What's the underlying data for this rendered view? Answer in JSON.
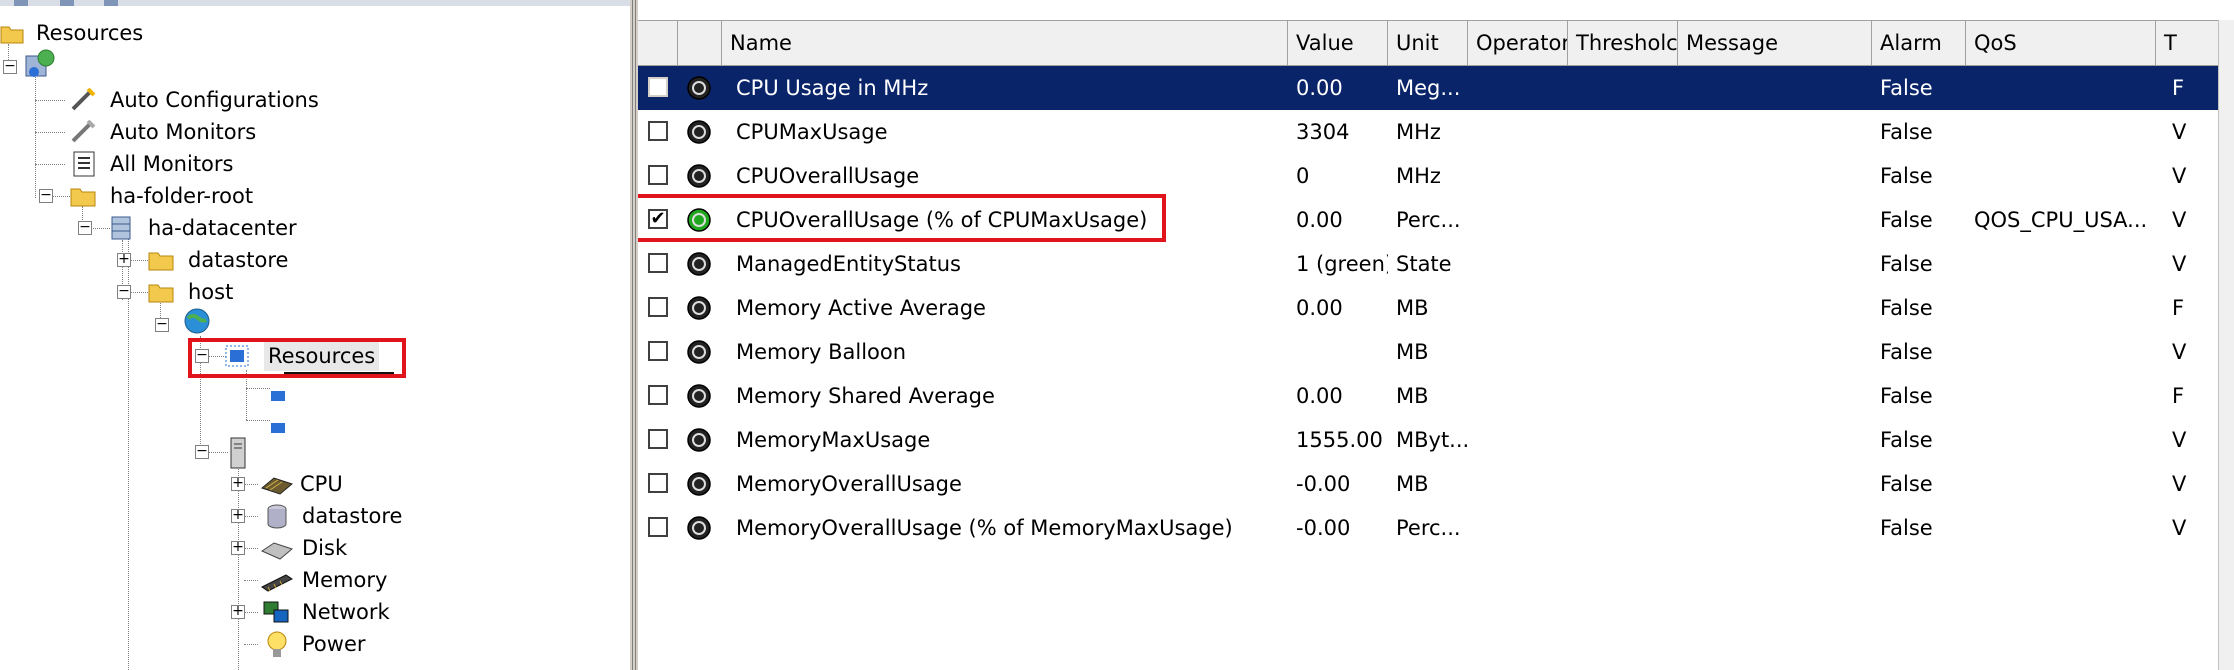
{
  "tree": {
    "root_label": "Resources",
    "items": [
      {
        "label": "Auto Configurations",
        "icon": "wand-icon"
      },
      {
        "label": "Auto Monitors",
        "icon": "wand-icon"
      },
      {
        "label": "All Monitors",
        "icon": "list-icon"
      },
      {
        "label": "ha-folder-root",
        "icon": "folder-icon"
      },
      {
        "label": "ha-datacenter",
        "icon": "datacenter-icon"
      },
      {
        "label": "datastore",
        "icon": "folder-icon"
      },
      {
        "label": "host",
        "icon": "folder-icon"
      },
      {
        "label": "Resources",
        "icon": "resource-pool-icon"
      },
      {
        "label": "CPU",
        "icon": "cpu-icon"
      },
      {
        "label": "datastore",
        "icon": "database-icon"
      },
      {
        "label": "Disk",
        "icon": "disk-icon"
      },
      {
        "label": "Memory",
        "icon": "memory-icon"
      },
      {
        "label": "Network",
        "icon": "network-icon"
      },
      {
        "label": "Power",
        "icon": "power-bulb-icon"
      }
    ]
  },
  "list": {
    "headers": [
      "Name",
      "Value",
      "Unit",
      "Operator",
      "Thresholc",
      "Message",
      "Alarm",
      "QoS",
      "T"
    ],
    "rows": [
      {
        "checked": false,
        "status": "grey",
        "name": "CPU Usage in MHz",
        "value": "0.00",
        "unit": "Meg...",
        "alarm": "False",
        "qos": "",
        "t": "F"
      },
      {
        "checked": false,
        "status": "grey",
        "name": "CPUMaxUsage",
        "value": "3304",
        "unit": "MHz",
        "alarm": "False",
        "qos": "",
        "t": "V"
      },
      {
        "checked": false,
        "status": "grey",
        "name": "CPUOverallUsage",
        "value": "0",
        "unit": "MHz",
        "alarm": "False",
        "qos": "",
        "t": "V"
      },
      {
        "checked": true,
        "status": "green",
        "name": "CPUOverallUsage (% of CPUMaxUsage)",
        "value": "0.00",
        "unit": "Perc...",
        "alarm": "False",
        "qos": "QOS_CPU_USA...",
        "t": "V"
      },
      {
        "checked": false,
        "status": "grey",
        "name": "ManagedEntityStatus",
        "value": "1 (green)",
        "unit": "State",
        "alarm": "False",
        "qos": "",
        "t": "V"
      },
      {
        "checked": false,
        "status": "grey",
        "name": "Memory Active Average",
        "value": "0.00",
        "unit": "MB",
        "alarm": "False",
        "qos": "",
        "t": "F"
      },
      {
        "checked": false,
        "status": "grey",
        "name": "Memory Balloon",
        "value": "",
        "unit": "MB",
        "alarm": "False",
        "qos": "",
        "t": "V"
      },
      {
        "checked": false,
        "status": "grey",
        "name": "Memory Shared Average",
        "value": "0.00",
        "unit": "MB",
        "alarm": "False",
        "qos": "",
        "t": "F"
      },
      {
        "checked": false,
        "status": "grey",
        "name": "MemoryMaxUsage",
        "value": "1555.00",
        "unit": "MByt...",
        "alarm": "False",
        "qos": "",
        "t": "V"
      },
      {
        "checked": false,
        "status": "grey",
        "name": "MemoryOverallUsage",
        "value": "-0.00",
        "unit": "MB",
        "alarm": "False",
        "qos": "",
        "t": "V"
      },
      {
        "checked": false,
        "status": "grey",
        "name": "MemoryOverallUsage (% of MemoryMaxUsage)",
        "value": "-0.00",
        "unit": "Perc...",
        "alarm": "False",
        "qos": "",
        "t": "V"
      }
    ]
  },
  "colors": {
    "selection": "#0a246a",
    "highlight": "#e0141a",
    "status_green": "#1fa81f",
    "status_grey": "#222222"
  }
}
